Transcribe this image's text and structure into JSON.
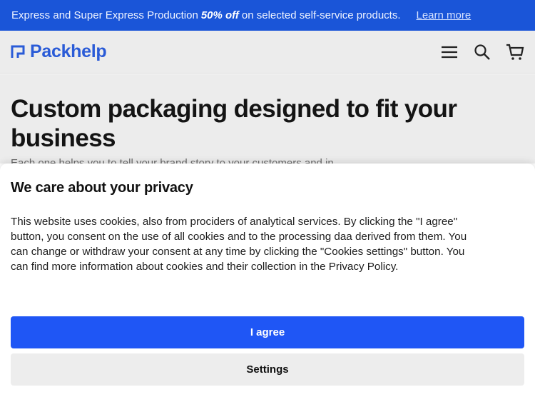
{
  "banner": {
    "text_before": "Express and Super Express Production",
    "highlight": "50% off",
    "text_after": "on selected self-service products.",
    "link": "Learn more"
  },
  "header": {
    "logo_text": "Packhelp",
    "icons": [
      "menu-icon",
      "search-icon",
      "cart-icon"
    ]
  },
  "hero": {
    "title": "Custom packaging designed to fit your business",
    "subtitle": "Each one helps you to tell your brand story to your customers and in..."
  },
  "consent": {
    "title": "We care about your privacy",
    "body_start": "This website uses cookies, also from prociders of analytical services. By clicking the \"I agree\" button, you consent on the use of all cookies and to the processing daa derived from them. You can change or withdraw your consent at any time by clicking the \"Cookies settings\" button. You can find more information about cookies and their collection in the ",
    "policy_link": "Privacy Policy",
    "body_end": ".",
    "agree_label": "I agree",
    "settings_label": "Settings"
  },
  "colors": {
    "brand": "#2a5bd7",
    "primary_button": "#1f56f5",
    "banner": "#1a55d8"
  }
}
